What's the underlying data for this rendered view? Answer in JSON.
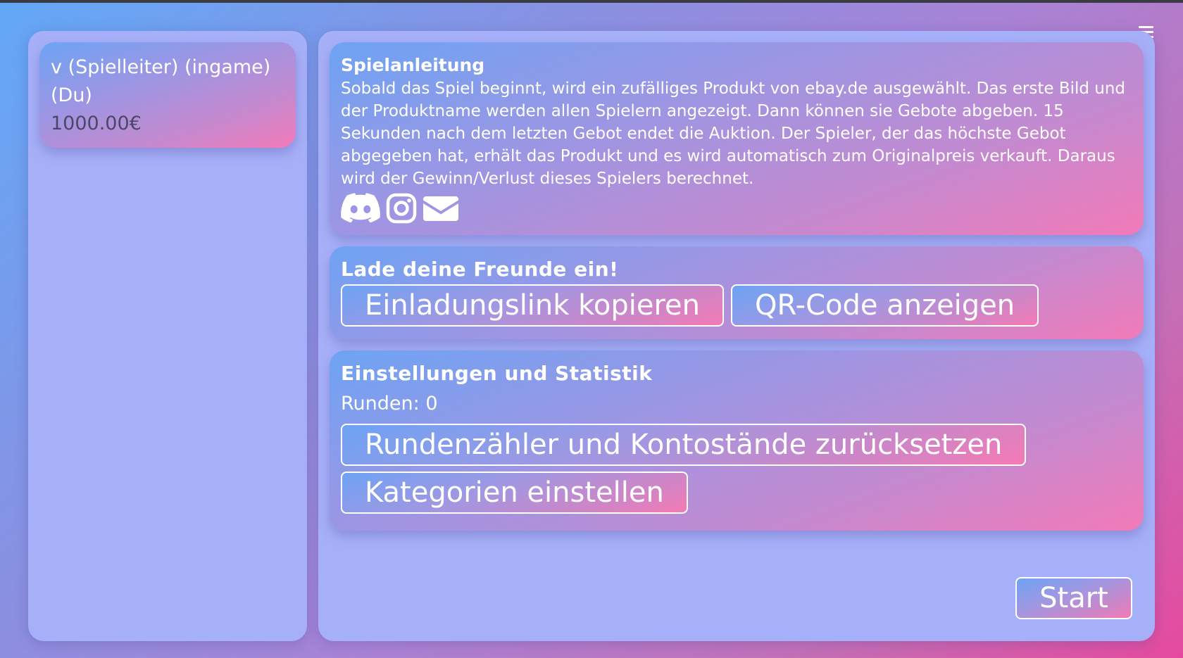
{
  "menu": {
    "icon": "hamburger-menu-icon"
  },
  "players": [
    {
      "name": "v (Spielleiter) (ingame) (Du)",
      "balance": "1000.00€"
    }
  ],
  "instructions": {
    "title": "Spielanleitung",
    "text": "Sobald das Spiel beginnt, wird ein zufälliges Produkt von ebay.de ausgewählt. Das erste Bild und der Produktname werden allen Spielern angezeigt. Dann können sie Gebote abgeben. 15 Sekunden nach dem letzten Gebot endet die Auktion. Der Spieler, der das höchste Gebot abgegeben hat, erhält das Produkt und es wird automatisch zum Originalpreis verkauft. Daraus wird der Gewinn/Verlust dieses Spielers berechnet.",
    "social_icons": [
      "discord-icon",
      "instagram-icon",
      "mail-icon"
    ]
  },
  "invite": {
    "title": "Lade deine Freunde ein!",
    "copy_link_label": "Einladungslink kopieren",
    "qr_label": "QR-Code anzeigen"
  },
  "settings": {
    "title": "Einstellungen und Statistik",
    "rounds_text": "Runden: 0",
    "reset_label": "Rundenzähler und Kontostände zurücksetzen",
    "categories_label": "Kategorien einstellen"
  },
  "start_label": "Start",
  "colors": {
    "panel": "#a6b0f8",
    "gradient_start": "#6ea3f4",
    "gradient_end": "#f27ab8",
    "balance_text": "#4a4868"
  }
}
